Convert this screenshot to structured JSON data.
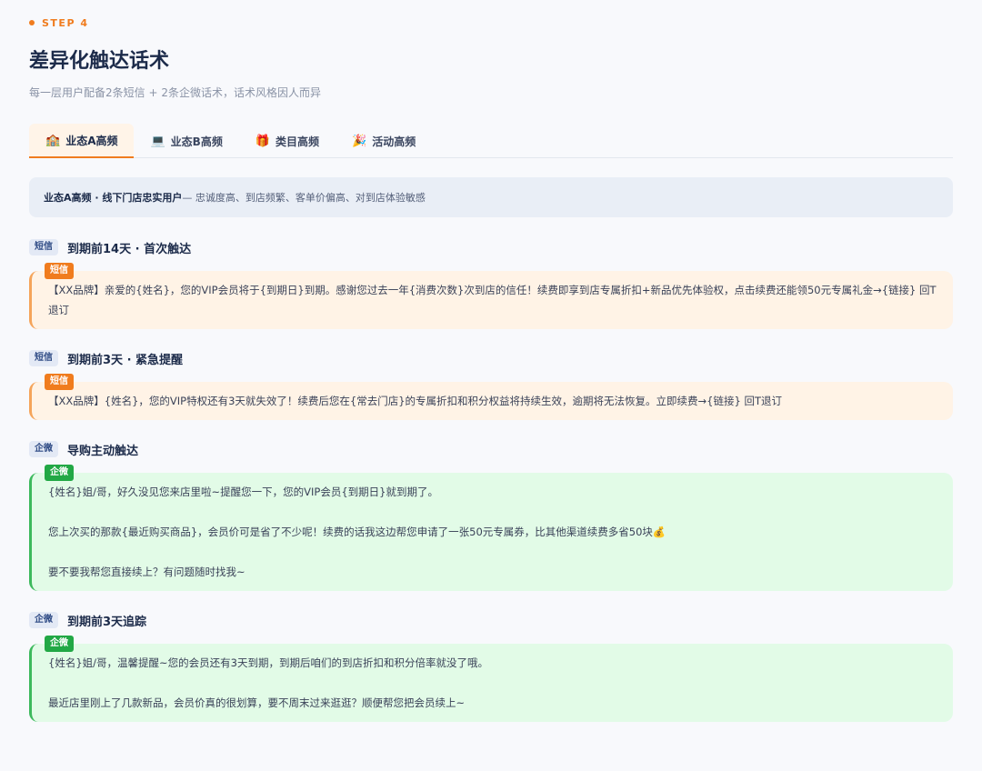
{
  "header": {
    "step": "STEP 4",
    "title": "差异化触达话术",
    "subtitle": "每一层用户配备2条短信 + 2条企微话术，话术风格因人而异"
  },
  "tabs": [
    {
      "icon": "🏫",
      "icon_name": "school-icon",
      "label": "业态A高频"
    },
    {
      "icon": "💻",
      "icon_name": "laptop-icon",
      "label": "业态B高频"
    },
    {
      "icon": "🎁",
      "icon_name": "gift-icon",
      "label": "类目高频"
    },
    {
      "icon": "🎉",
      "icon_name": "party-popper-icon",
      "label": "活动高频"
    }
  ],
  "info": {
    "strong": "业态A高频 · 线下门店忠实用户",
    "rest": " — 忠诚度高、到店频繁、客单价偏高、对到店体验敏感"
  },
  "sections": [
    {
      "tag": "短信",
      "title": "到期前14天 · 首次触达",
      "badge": "短信",
      "lines": [
        "【XX品牌】亲爱的{姓名}，您的VIP会员将于{到期日}到期。感谢您过去一年{消费次数}次到店的信任！续费即享到店专属折扣+新品优先体验权，点击续费还能领50元专属礼金→{链接} 回T退订"
      ]
    },
    {
      "tag": "短信",
      "title": "到期前3天 · 紧急提醒",
      "badge": "短信",
      "lines": [
        "【XX品牌】{姓名}，您的VIP特权还有3天就失效了！续费后您在{常去门店}的专属折扣和积分权益将持续生效，逾期将无法恢复。立即续费→{链接} 回T退订"
      ]
    },
    {
      "tag": "企微",
      "title": "导购主动触达",
      "badge": "企微",
      "lines": [
        "{姓名}姐/哥，好久没见您来店里啦~提醒您一下，您的VIP会员{到期日}就到期了。",
        "您上次买的那款{最近购买商品}，会员价可是省了不少呢！续费的话我这边帮您申请了一张50元专属券，比其他渠道续费多省50块💰",
        "要不要我帮您直接续上？有问题随时找我~"
      ]
    },
    {
      "tag": "企微",
      "title": "到期前3天追踪",
      "badge": "企微",
      "lines": [
        "{姓名}姐/哥，温馨提醒~您的会员还有3天到期，到期后咱们的到店折扣和积分倍率就没了哦。",
        "最近店里刚上了几款新品，会员价真的很划算，要不周末过来逛逛？顺便帮您把会员续上~"
      ]
    }
  ]
}
